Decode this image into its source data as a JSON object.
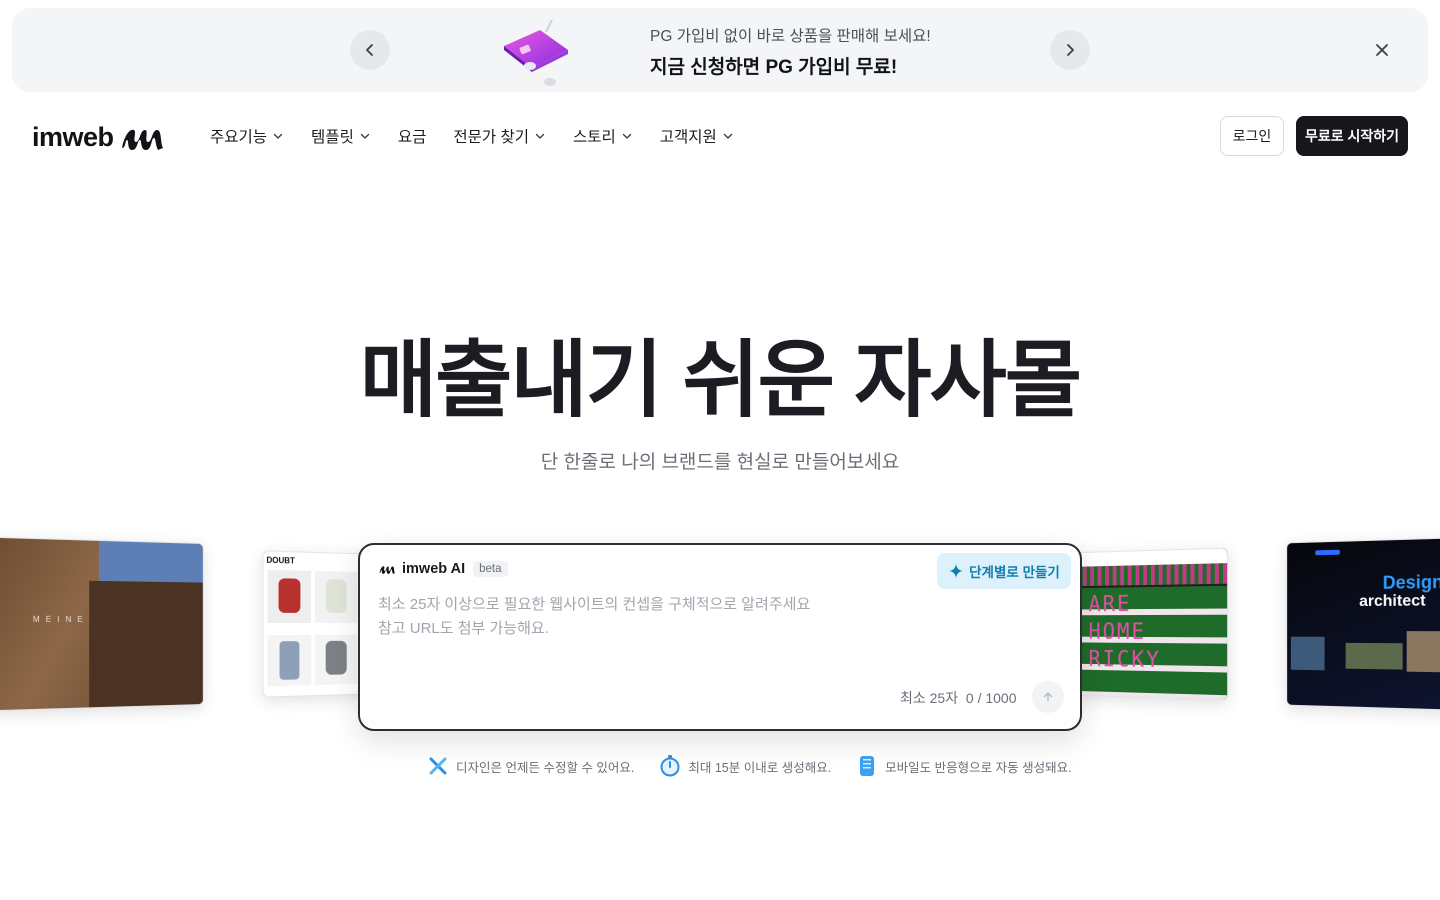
{
  "banner": {
    "subtitle": "PG 가입비 없이 바로 상품을 판매해 보세요!",
    "title": "지금 신청하면 PG 가입비 무료!",
    "prev_icon": "chevron-left-icon",
    "next_icon": "chevron-right-icon",
    "close_icon": "close-icon"
  },
  "brand": {
    "name": "imweb"
  },
  "nav": {
    "items": [
      {
        "label": "주요기능",
        "dropdown": true
      },
      {
        "label": "템플릿",
        "dropdown": true
      },
      {
        "label": "요금",
        "dropdown": false
      },
      {
        "label": "전문가 찾기",
        "dropdown": true
      },
      {
        "label": "스토리",
        "dropdown": true
      },
      {
        "label": "고객지원",
        "dropdown": true
      }
    ],
    "login": "로그인",
    "start": "무료로 시작하기"
  },
  "hero": {
    "title": "매출내기 쉬운 자사몰",
    "subtitle": "단 한줄로 나의 브랜드를 현실로 만들어보세요"
  },
  "cards": {
    "left_1": "MEINE",
    "left_2": "DOUBT",
    "right_1": [
      "ARE",
      "HOME",
      "RICKY"
    ],
    "right_2": {
      "title_1": "Design",
      "title_2": "architect"
    }
  },
  "ai": {
    "name": "imweb AI",
    "badge": "beta",
    "step_button": "단계별로 만들기",
    "placeholder": "최소 25자 이상으로 필요한 웹사이트의 컨셉을 구체적으로 알려주세요\n참고 URL도 첨부 가능해요.",
    "value": "",
    "min_label": "최소 25자",
    "count": "0 / 1000"
  },
  "features": [
    {
      "icon": "design-tools-icon",
      "text": "디자인은 언제든 수정할 수 있어요."
    },
    {
      "icon": "stopwatch-icon",
      "text": "최대 15분 이내로 생성해요."
    },
    {
      "icon": "mobile-phone-icon",
      "text": "모바일도 반응형으로 자동 생성돼요."
    }
  ],
  "colors": {
    "accent": "#137fb0",
    "accent_bg": "#dcf1fb",
    "primary_dark": "#15171b",
    "banner_bg": "#f4f5f7"
  }
}
